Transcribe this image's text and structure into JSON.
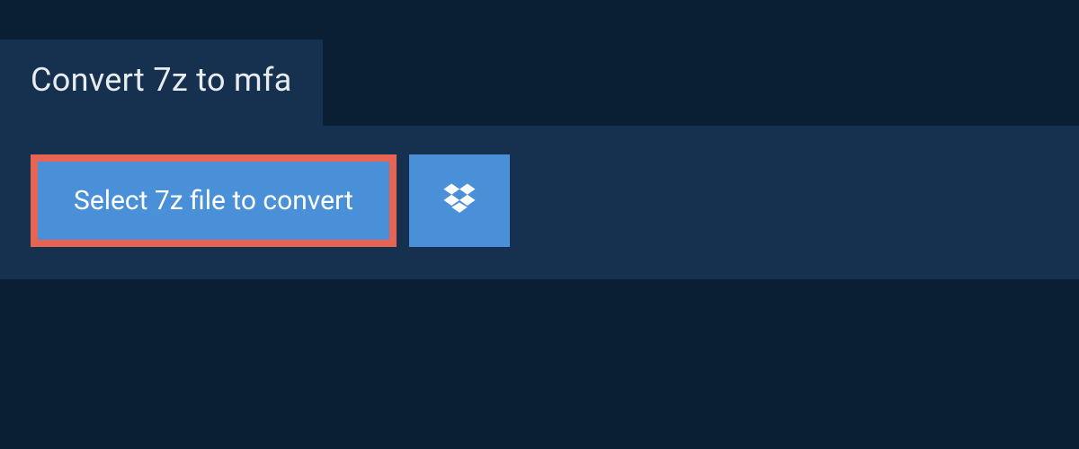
{
  "header": {
    "title": "Convert 7z to mfa"
  },
  "actions": {
    "select_label": "Select 7z file to convert",
    "dropbox_icon": "dropbox-icon"
  },
  "colors": {
    "accent": "#4a90d9",
    "highlight_border": "#e76352",
    "panel": "#15314f",
    "bg": "#0a1f33"
  }
}
